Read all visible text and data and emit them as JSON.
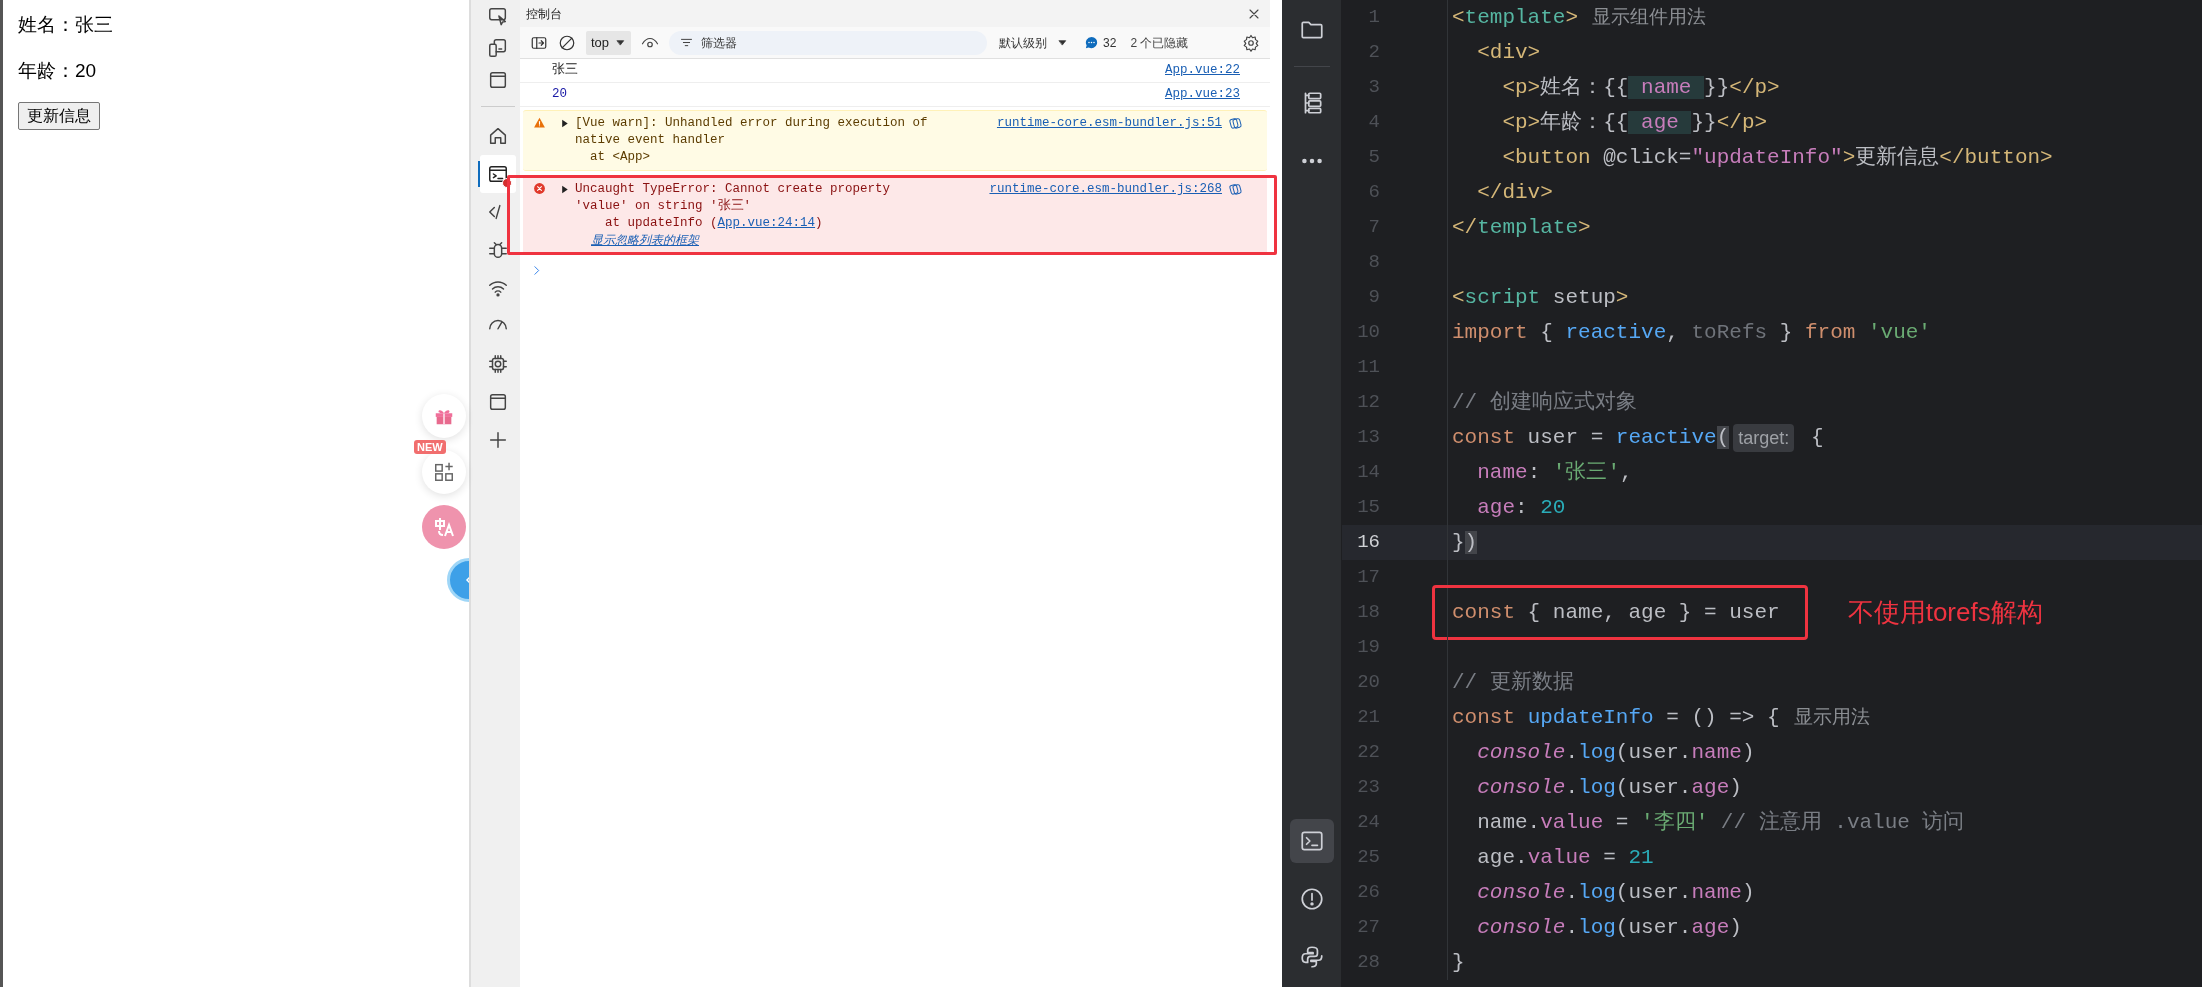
{
  "page": {
    "name_line": "姓名：张三",
    "age_line": "年龄：20",
    "button": "更新信息",
    "floating": [
      {
        "kind": "gift"
      },
      {
        "kind": "apps",
        "badge": "NEW"
      },
      {
        "kind": "translate"
      },
      {
        "kind": "assistant"
      }
    ]
  },
  "devtools": {
    "tools": [
      {
        "kind": "inspect",
        "selected": false,
        "badge": false
      },
      {
        "kind": "device",
        "selected": false,
        "badge": false
      },
      {
        "kind": "window",
        "selected": false,
        "badge": false
      },
      {
        "kind": "home",
        "selected": false,
        "badge": false
      },
      {
        "kind": "console",
        "selected": true,
        "badge": true
      },
      {
        "kind": "code",
        "selected": false,
        "badge": false
      },
      {
        "kind": "bug",
        "selected": false,
        "badge": false
      },
      {
        "kind": "wifi",
        "selected": false,
        "badge": false
      },
      {
        "kind": "gauge",
        "selected": false,
        "badge": false
      },
      {
        "kind": "chip",
        "selected": false,
        "badge": false
      },
      {
        "kind": "window",
        "selected": false,
        "badge": false
      },
      {
        "kind": "plus",
        "selected": false,
        "badge": false
      }
    ],
    "panel_title": "控制台",
    "toolbar": {
      "context": "top",
      "filter_placeholder": "筛选器",
      "level": "默认级别",
      "message_count": "32",
      "hidden": "2 个已隐藏"
    },
    "messages": [
      {
        "kind": "log",
        "expandable": false,
        "boxed": false,
        "lines": [
          "张三"
        ],
        "source": "App.vue:22"
      },
      {
        "kind": "number",
        "expandable": false,
        "boxed": false,
        "lines": [
          "20"
        ],
        "source": "App.vue:23"
      },
      {
        "kind": "warning",
        "expandable": true,
        "boxed": false,
        "lines": [
          "[Vue warn]: Unhandled error during execution of",
          "native event handler",
          "  at <App>"
        ],
        "source": "runtime-core.esm-bundler.js:51"
      },
      {
        "kind": "error",
        "expandable": true,
        "boxed": true,
        "lines": [
          "Uncaught TypeError: Cannot create property",
          "'value' on string '张三'"
        ],
        "trace": {
          "prefix": "    at updateInfo (",
          "link": "App.vue:24:14",
          "suffix": ")"
        },
        "ignore_link": "显示忽略列表的框架",
        "source": "runtime-core.esm-bundler.js:268"
      }
    ]
  },
  "editor": {
    "top_tools": [
      {
        "kind": "folder",
        "selected": false
      },
      {
        "kind": "structure",
        "selected": false
      },
      {
        "kind": "more",
        "selected": false
      }
    ],
    "bottom_tools": [
      {
        "kind": "terminal",
        "selected": true
      },
      {
        "kind": "problems",
        "selected": false
      },
      {
        "kind": "python",
        "selected": false
      }
    ],
    "lines": [
      {
        "number": "1",
        "current": false,
        "boxed": false,
        "tokens": [
          {
            "kind": "tag",
            "text": "<"
          },
          {
            "kind": "vtag",
            "text": "template"
          },
          {
            "kind": "tag",
            "text": ">"
          },
          {
            "kind": "hint",
            "text": "显示组件用法"
          }
        ]
      },
      {
        "number": "2",
        "current": false,
        "boxed": false,
        "tokens": [
          {
            "kind": "tag",
            "text": "  <div>"
          }
        ]
      },
      {
        "number": "3",
        "current": false,
        "boxed": false,
        "tokens": [
          {
            "kind": "tag",
            "text": "    <p>"
          },
          {
            "kind": "plain",
            "text": "姓名：{{"
          },
          {
            "kind": "interp",
            "text": " name "
          },
          {
            "kind": "plain",
            "text": "}}"
          },
          {
            "kind": "tag",
            "text": "</p>"
          }
        ]
      },
      {
        "number": "4",
        "current": false,
        "boxed": false,
        "tokens": [
          {
            "kind": "tag",
            "text": "    <p>"
          },
          {
            "kind": "plain",
            "text": "年龄：{{"
          },
          {
            "kind": "interp",
            "text": " age "
          },
          {
            "kind": "plain",
            "text": "}}"
          },
          {
            "kind": "tag",
            "text": "</p>"
          }
        ]
      },
      {
        "number": "5",
        "current": false,
        "boxed": false,
        "tokens": [
          {
            "kind": "tag",
            "text": "    <button"
          },
          {
            "kind": "plain",
            "text": " @click="
          },
          {
            "kind": "attrval",
            "text": "\"updateInfo\""
          },
          {
            "kind": "tag",
            "text": ">"
          },
          {
            "kind": "plain",
            "text": "更新信息"
          },
          {
            "kind": "tag",
            "text": "</button>"
          }
        ]
      },
      {
        "number": "6",
        "current": false,
        "boxed": false,
        "tokens": [
          {
            "kind": "tag",
            "text": "  </div>"
          }
        ]
      },
      {
        "number": "7",
        "current": false,
        "boxed": false,
        "tokens": [
          {
            "kind": "tag",
            "text": "</"
          },
          {
            "kind": "vtag",
            "text": "template"
          },
          {
            "kind": "tag",
            "text": ">"
          }
        ]
      },
      {
        "number": "8",
        "current": false,
        "boxed": false
      },
      {
        "number": "9",
        "current": false,
        "boxed": false,
        "tokens": [
          {
            "kind": "tag",
            "text": "<"
          },
          {
            "kind": "vtag",
            "text": "script"
          },
          {
            "kind": "plain",
            "text": " setup"
          },
          {
            "kind": "tag",
            "text": ">"
          }
        ]
      },
      {
        "number": "10",
        "current": false,
        "boxed": false,
        "tokens": [
          {
            "kind": "keyword",
            "text": "import"
          },
          {
            "kind": "plain",
            "text": " { "
          },
          {
            "kind": "fn",
            "text": "reactive"
          },
          {
            "kind": "plain",
            "text": ", "
          },
          {
            "kind": "unused",
            "text": "toRefs"
          },
          {
            "kind": "plain",
            "text": " } "
          },
          {
            "kind": "keyword",
            "text": "from "
          },
          {
            "kind": "string",
            "text": "'vue'"
          }
        ]
      },
      {
        "number": "11",
        "current": false,
        "boxed": false
      },
      {
        "number": "12",
        "current": false,
        "boxed": false,
        "tokens": [
          {
            "kind": "comment",
            "text": "// 创建响应式对象"
          }
        ]
      },
      {
        "number": "13",
        "current": false,
        "boxed": false,
        "tokens": [
          {
            "kind": "keyword",
            "text": "const"
          },
          {
            "kind": "plain",
            "text": " user = "
          },
          {
            "kind": "fn",
            "text": "reactive"
          },
          {
            "kind": "match",
            "text": "("
          },
          {
            "kind": "param",
            "text": "target:"
          },
          {
            "kind": "plain",
            "text": " {"
          }
        ]
      },
      {
        "number": "14",
        "current": false,
        "boxed": false,
        "tokens": [
          {
            "kind": "prop",
            "text": "  name"
          },
          {
            "kind": "plain",
            "text": ": "
          },
          {
            "kind": "string",
            "text": "'张三'"
          },
          {
            "kind": "plain",
            "text": ","
          }
        ]
      },
      {
        "number": "15",
        "current": false,
        "boxed": false,
        "tokens": [
          {
            "kind": "prop",
            "text": "  age"
          },
          {
            "kind": "plain",
            "text": ": "
          },
          {
            "kind": "number",
            "text": "20"
          }
        ]
      },
      {
        "number": "16",
        "current": true,
        "boxed": false,
        "tokens": [
          {
            "kind": "plain",
            "text": "}"
          },
          {
            "kind": "match",
            "text": ")"
          }
        ]
      },
      {
        "number": "17",
        "current": false,
        "boxed": false
      },
      {
        "number": "18",
        "current": false,
        "boxed": true,
        "note": "不使用torefs解构",
        "tokens": [
          {
            "kind": "keyword",
            "text": "const"
          },
          {
            "kind": "plain",
            "text": " { name, age } = user"
          }
        ]
      },
      {
        "number": "19",
        "current": false,
        "boxed": false
      },
      {
        "number": "20",
        "current": false,
        "boxed": false,
        "tokens": [
          {
            "kind": "comment",
            "text": "// 更新数据"
          }
        ]
      },
      {
        "number": "21",
        "current": false,
        "boxed": false,
        "tokens": [
          {
            "kind": "keyword",
            "text": "const "
          },
          {
            "kind": "fn",
            "text": "updateInfo"
          },
          {
            "kind": "plain",
            "text": " = () => {"
          },
          {
            "kind": "hint",
            "text": "显示用法"
          }
        ]
      },
      {
        "number": "22",
        "current": false,
        "boxed": false,
        "tokens": [
          {
            "kind": "italic",
            "text": "  console"
          },
          {
            "kind": "plain",
            "text": "."
          },
          {
            "kind": "fn",
            "text": "log"
          },
          {
            "kind": "plain",
            "text": "(user."
          },
          {
            "kind": "prop",
            "text": "name"
          },
          {
            "kind": "plain",
            "text": ")"
          }
        ]
      },
      {
        "number": "23",
        "current": false,
        "boxed": false,
        "tokens": [
          {
            "kind": "italic",
            "text": "  console"
          },
          {
            "kind": "plain",
            "text": "."
          },
          {
            "kind": "fn",
            "text": "log"
          },
          {
            "kind": "plain",
            "text": "(user."
          },
          {
            "kind": "prop",
            "text": "age"
          },
          {
            "kind": "plain",
            "text": ")"
          }
        ]
      },
      {
        "number": "24",
        "current": false,
        "boxed": false,
        "tokens": [
          {
            "kind": "plain",
            "text": "  name."
          },
          {
            "kind": "prop",
            "text": "value"
          },
          {
            "kind": "plain",
            "text": " = "
          },
          {
            "kind": "string",
            "text": "'李四'"
          },
          {
            "kind": "comment",
            "text": " // 注意用 .value 访问"
          }
        ]
      },
      {
        "number": "25",
        "current": false,
        "boxed": false,
        "tokens": [
          {
            "kind": "plain",
            "text": "  age."
          },
          {
            "kind": "prop",
            "text": "value"
          },
          {
            "kind": "plain",
            "text": " = "
          },
          {
            "kind": "number",
            "text": "21"
          }
        ]
      },
      {
        "number": "26",
        "current": false,
        "boxed": false,
        "tokens": [
          {
            "kind": "italic",
            "text": "  console"
          },
          {
            "kind": "plain",
            "text": "."
          },
          {
            "kind": "fn",
            "text": "log"
          },
          {
            "kind": "plain",
            "text": "(user."
          },
          {
            "kind": "prop",
            "text": "name"
          },
          {
            "kind": "plain",
            "text": ")"
          }
        ]
      },
      {
        "number": "27",
        "current": false,
        "boxed": false,
        "tokens": [
          {
            "kind": "italic",
            "text": "  console"
          },
          {
            "kind": "plain",
            "text": "."
          },
          {
            "kind": "fn",
            "text": "log"
          },
          {
            "kind": "plain",
            "text": "(user."
          },
          {
            "kind": "prop",
            "text": "age"
          },
          {
            "kind": "plain",
            "text": ")"
          }
        ]
      },
      {
        "number": "28",
        "current": false,
        "boxed": false,
        "tokens": [
          {
            "kind": "plain",
            "text": "}"
          }
        ]
      }
    ]
  }
}
